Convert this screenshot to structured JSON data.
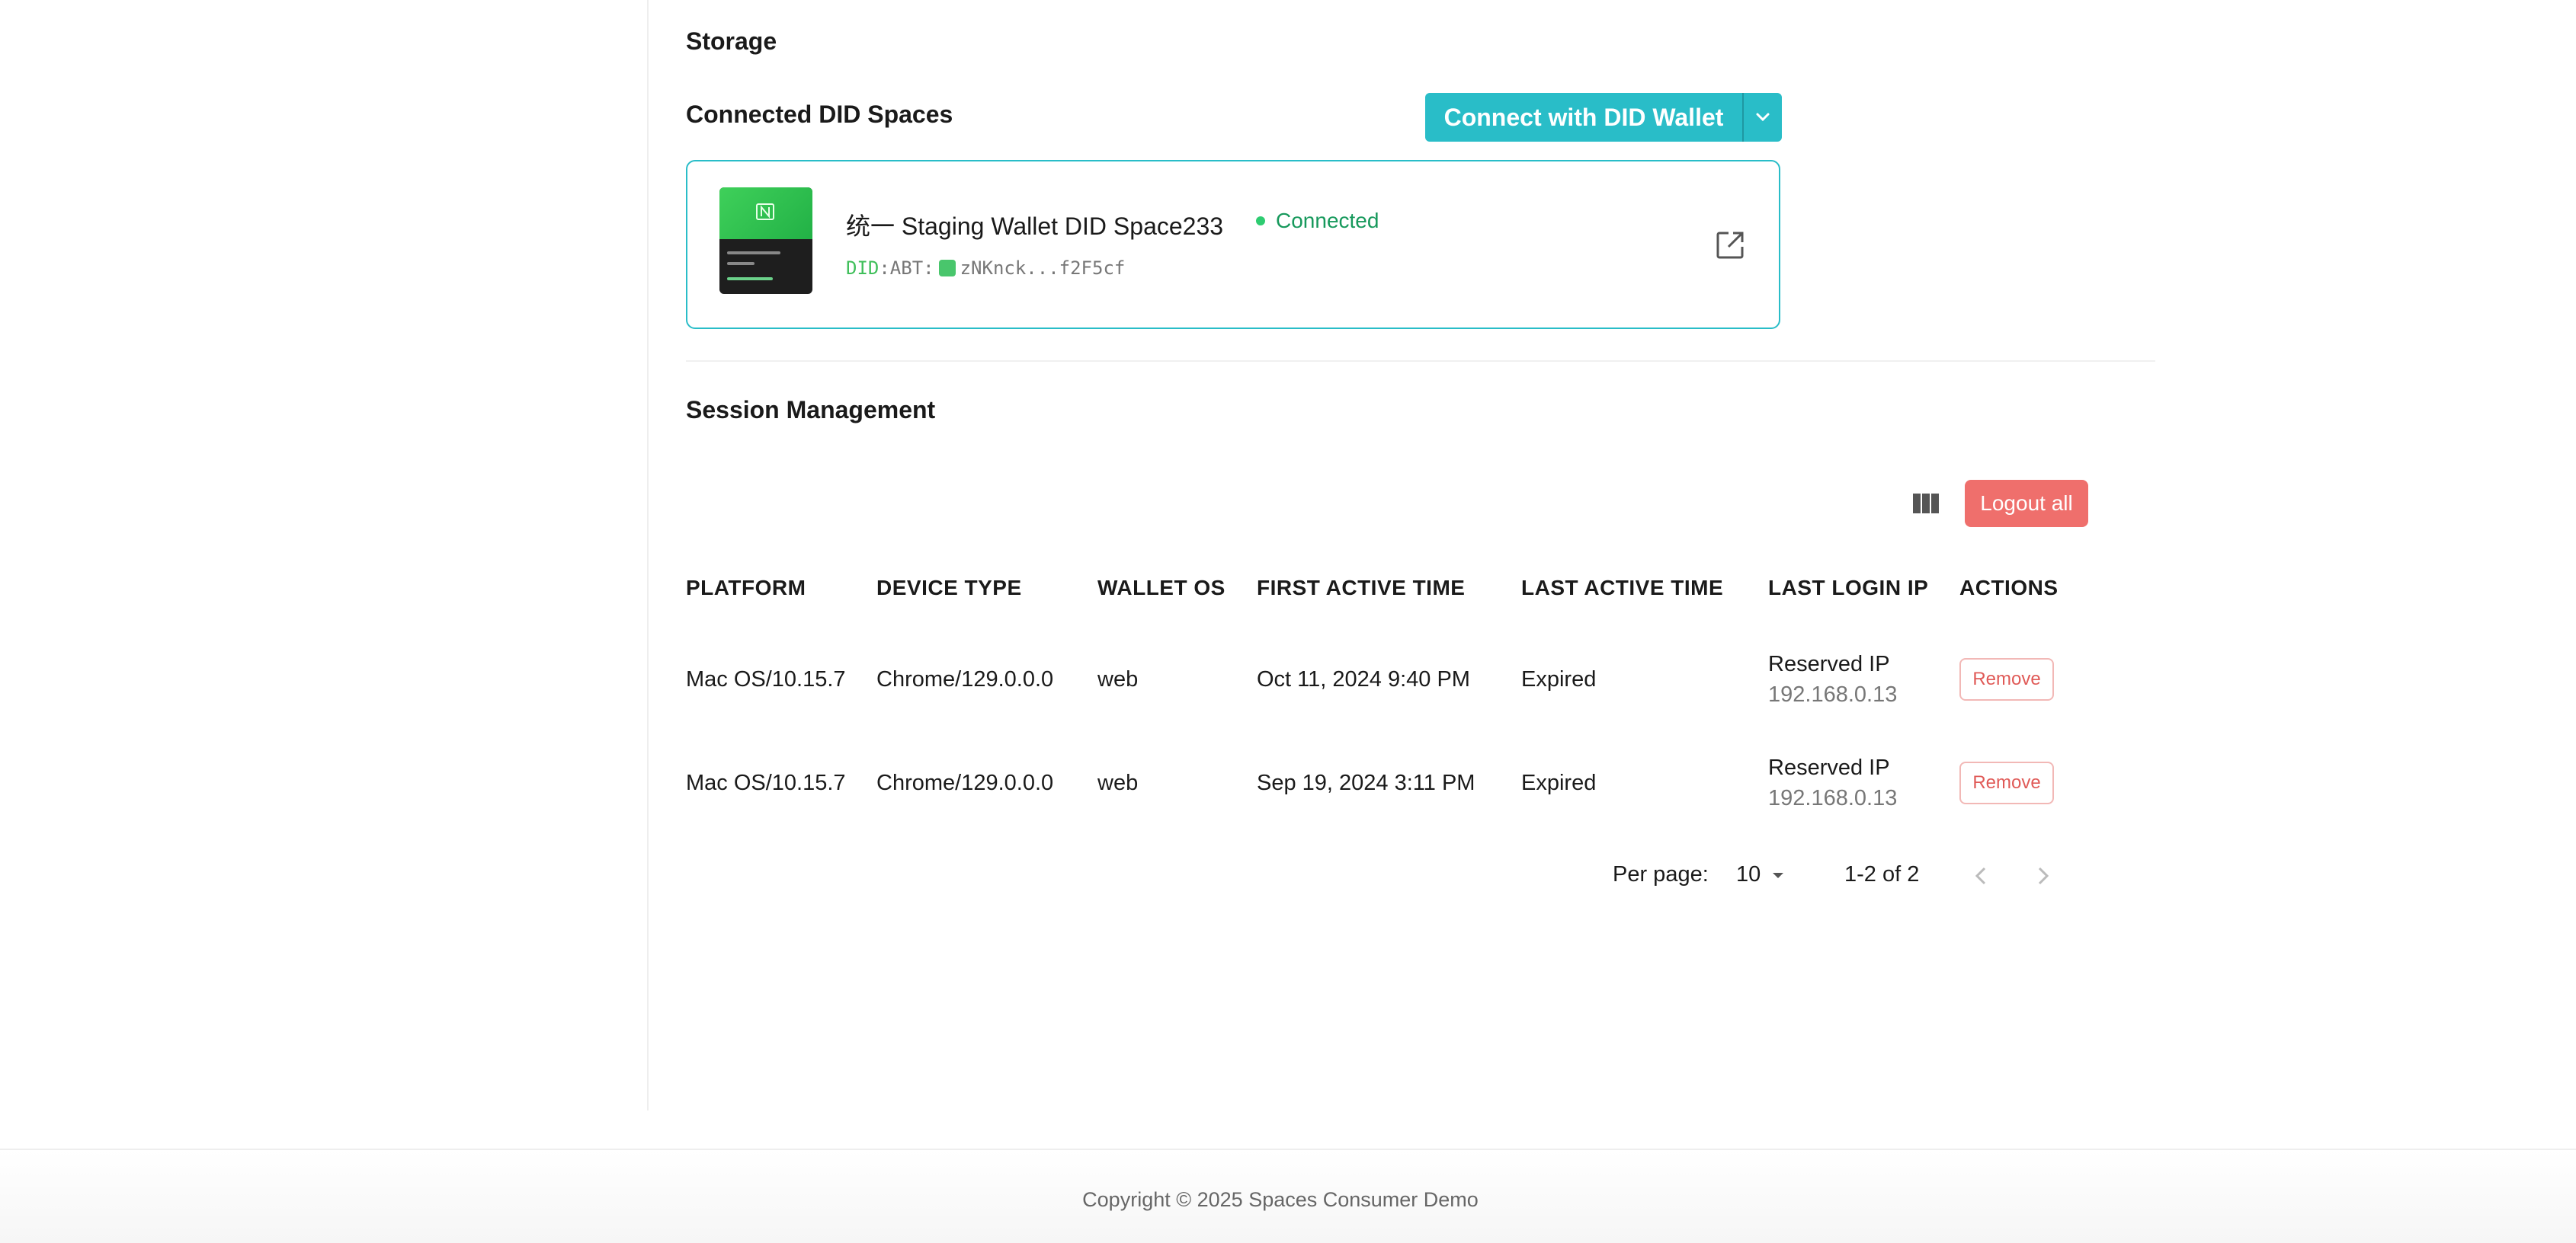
{
  "storage": {
    "title": "Storage",
    "section_title": "Connected DID Spaces",
    "connect_label": "Connect with DID Wallet",
    "space": {
      "name": "统一 Staging Wallet DID Space233",
      "status": "Connected",
      "did_prefix": "DID",
      "did_rest": ":ABT:",
      "did_value": "zNKnck...f2F5cf"
    }
  },
  "sessions": {
    "title": "Session Management",
    "logout_all_label": "Logout all",
    "columns": [
      "PLATFORM",
      "DEVICE TYPE",
      "WALLET OS",
      "FIRST ACTIVE TIME",
      "LAST ACTIVE TIME",
      "LAST LOGIN IP",
      "ACTIONS"
    ],
    "rows": [
      {
        "platform": "Mac OS/10.15.7",
        "device_type": "Chrome/129.0.0.0",
        "wallet_os": "web",
        "first_active": "Oct 11, 2024 9:40 PM",
        "last_active": "Expired",
        "ip_label": "Reserved IP",
        "ip": "192.168.0.13",
        "action": "Remove"
      },
      {
        "platform": "Mac OS/10.15.7",
        "device_type": "Chrome/129.0.0.0",
        "wallet_os": "web",
        "first_active": "Sep 19, 2024 3:11 PM",
        "last_active": "Expired",
        "ip_label": "Reserved IP",
        "ip": "192.168.0.13",
        "action": "Remove"
      }
    ],
    "pagination": {
      "per_page_label": "Per page:",
      "per_page_value": "10",
      "range": "1-2 of 2"
    }
  },
  "footer": {
    "copyright": "Copyright © 2025 Spaces Consumer Demo"
  },
  "colors": {
    "accent": "#29bdc8",
    "danger": "#ef6f6c",
    "connected": "#17995c"
  }
}
